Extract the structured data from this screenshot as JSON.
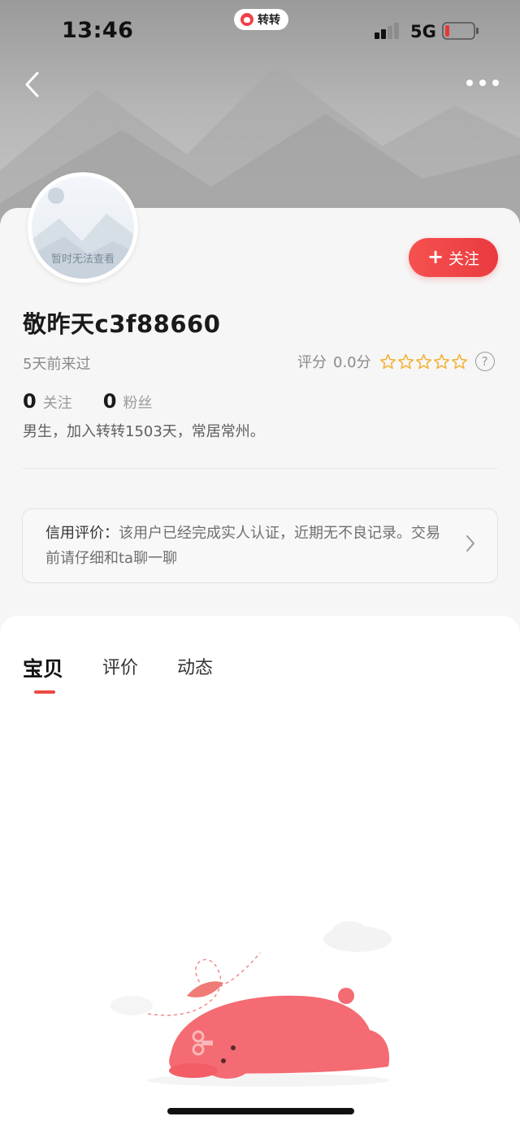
{
  "status_bar": {
    "time": "13:46",
    "app_pill": "转转",
    "network": "5G"
  },
  "nav": {
    "back_icon": "chevron-left-icon",
    "more_icon": "more-dots-icon"
  },
  "profile": {
    "avatar_placeholder": "暂时无法查看",
    "follow_label": "关注",
    "username": "敬昨天c3f88660",
    "last_seen": "5天前来过",
    "rating_label": "评分",
    "rating_value": "0.0分",
    "stars": 0,
    "stars_total": 5,
    "following_count": "0",
    "following_label": "关注",
    "followers_count": "0",
    "followers_label": "粉丝",
    "bio": "男生，加入转转1503天，常居常州。"
  },
  "credit": {
    "title": "信用评价：",
    "text": "该用户已经完成实人认证，近期无不良记录。交易前请仔细和ta聊一聊"
  },
  "tabs": [
    {
      "label": "宝贝",
      "active": true
    },
    {
      "label": "评价",
      "active": false
    },
    {
      "label": "动态",
      "active": false
    }
  ],
  "colors": {
    "accent": "#ea3a3f",
    "star": "#f2b233",
    "battery_low": "#e53935"
  }
}
